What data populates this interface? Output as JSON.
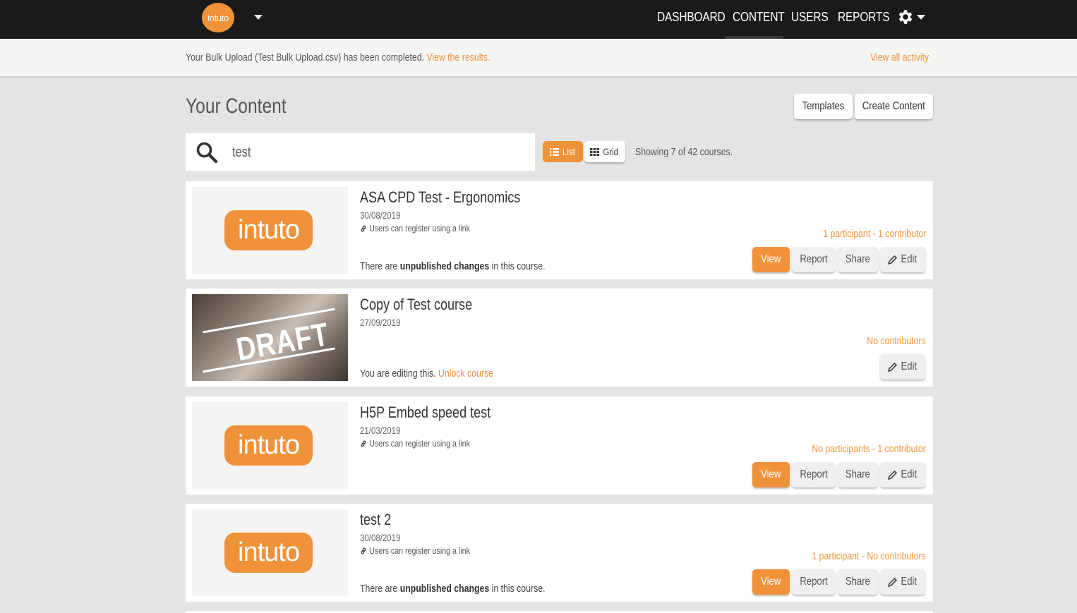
{
  "app": {
    "logo_text": "intuto",
    "nav": [
      {
        "label": "DASHBOARD"
      },
      {
        "label": "CONTENT"
      },
      {
        "label": "USERS"
      },
      {
        "label": "REPORTS"
      }
    ],
    "active_nav": "CONTENT",
    "settings_icon": "gear-icon"
  },
  "notice": {
    "text": "Your Bulk Upload (Test Bulk Upload.csv) has been completed.",
    "link": "View the results.",
    "view_all": "View all activity"
  },
  "page": {
    "title": "Your Content",
    "templates_label": "Templates",
    "create_label": "Create Content"
  },
  "search": {
    "value": "test",
    "list_label": "List",
    "grid_label": "Grid",
    "showing": "Showing 7 of 42 courses."
  },
  "courses": [
    {
      "title": "ASA CPD Test - Ergonomics",
      "date": "30/08/2019",
      "register": "Users can register using a link",
      "note_pre": "There are ",
      "note_bold": "unpublished changes",
      "note_post": " in this course.",
      "counts": "1 participant - 1 contributor",
      "view": "View",
      "report": "Report",
      "share": "Share",
      "edit": "Edit"
    },
    {
      "title": "Copy of Test course",
      "date": "27/09/2019",
      "draft_text": "DRAFT",
      "note_pre": "You are editing this. ",
      "note_link": "Unlock course",
      "counts": "No contributors",
      "edit": "Edit"
    },
    {
      "title": "H5P Embed speed test",
      "date": "21/03/2019",
      "register": "Users can register using a link",
      "counts": "No participants - 1 contributor",
      "view": "View",
      "report": "Report",
      "share": "Share",
      "edit": "Edit"
    },
    {
      "title": "test 2",
      "date": "30/08/2019",
      "register": "Users can register using a link",
      "note_pre": "There are ",
      "note_bold": "unpublished changes",
      "note_post": " in this course.",
      "counts": "1 participant - No contributors",
      "view": "View",
      "report": "Report",
      "share": "Share",
      "edit": "Edit"
    }
  ],
  "colors": {
    "accent": "#f0923a",
    "topbar": "#1b1a19",
    "background": "#e4e4e2"
  }
}
